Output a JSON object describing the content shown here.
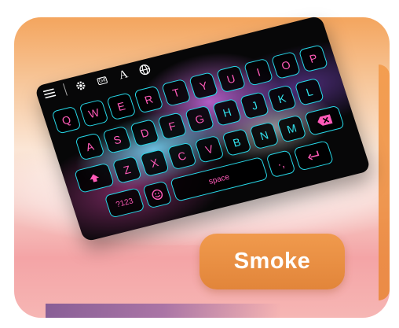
{
  "keyboard": {
    "topbar": {
      "menu_icon": "menu-icon",
      "settings_icon": "gear-icon",
      "gif_label": "Gif",
      "font_label": "A",
      "globe_icon": "globe-icon"
    },
    "rows": [
      [
        "Q",
        "W",
        "E",
        "R",
        "T",
        "Y",
        "U",
        "I",
        "O",
        "P"
      ],
      [
        "A",
        "S",
        "D",
        "F",
        "G",
        "H",
        "J",
        "K",
        "L"
      ],
      [
        "Z",
        "X",
        "C",
        "V",
        "B",
        "N",
        "M"
      ]
    ],
    "shift_icon": "shift-icon",
    "backspace_icon": "backspace-icon",
    "enter_icon": "enter-icon",
    "numbers_label": "?123",
    "emoji_icon": "emoji-icon",
    "comma_label": ",",
    "space_label": "space",
    "period_label": ".",
    "punct_label": "·,",
    "key_color": "#ff5ab8",
    "accent_color": "#26d8e8"
  },
  "theme": {
    "name": "Smoke"
  }
}
